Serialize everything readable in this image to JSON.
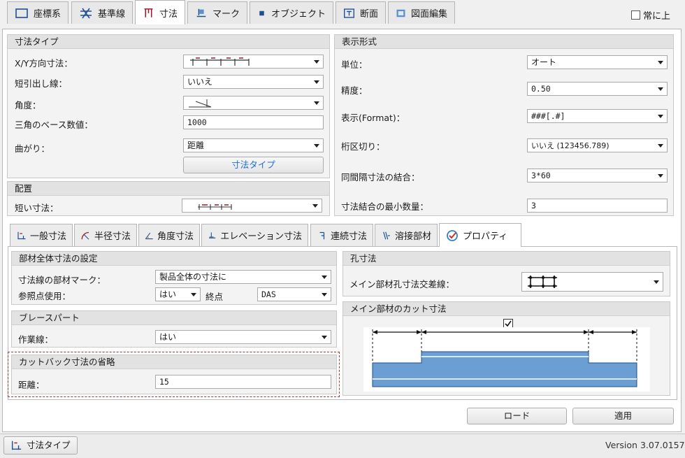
{
  "top_tabs": [
    {
      "label": "座標系",
      "icon": "coordinate-icon"
    },
    {
      "label": "基準線",
      "icon": "grid-icon"
    },
    {
      "label": "寸法",
      "icon": "dimension-icon"
    },
    {
      "label": "マーク",
      "icon": "mark-icon"
    },
    {
      "label": "オブジェクト",
      "icon": "object-icon"
    },
    {
      "label": "断面",
      "icon": "section-icon"
    },
    {
      "label": "図面編集",
      "icon": "drawing-edit-icon"
    }
  ],
  "always_on_top": {
    "label": "常に上",
    "checked": false
  },
  "dimension_type": {
    "title": "寸法タイプ",
    "xy_label": "X/Y方向寸法：",
    "leader_label": "短引出し線：",
    "leader_value": "いいえ",
    "angle_label": "角度：",
    "triangle_label": "三角のベース数値：",
    "triangle_value": "1000",
    "curve_label": "曲がり：",
    "curve_value": "距離",
    "button": "寸法タイプ"
  },
  "placement": {
    "title": "配置",
    "short_label": "短い寸法："
  },
  "display_format": {
    "title": "表示形式",
    "unit_label": "単位：",
    "unit_value": "オート",
    "precision_label": "精度：",
    "precision_value": "0.50",
    "format_label": "表示(Format)：",
    "format_value": "###[.#]",
    "digit_label": "桁区切り：",
    "digit_value": "いいえ (123456.789)",
    "combine_label": "同間隔寸法の結合：",
    "combine_value": "3*60",
    "min_label": "寸法結合の最小数量：",
    "min_value": "3"
  },
  "sub_tabs": [
    {
      "label": "一般寸法",
      "icon": "general-dimension-icon"
    },
    {
      "label": "半径寸法",
      "icon": "radius-dimension-icon"
    },
    {
      "label": "角度寸法",
      "icon": "angle-dimension-icon"
    },
    {
      "label": "エレベーション寸法",
      "icon": "elevation-dimension-icon"
    },
    {
      "label": "連続寸法",
      "icon": "continuous-dimension-icon"
    },
    {
      "label": "溶接部材",
      "icon": "weld-icon"
    },
    {
      "label": "プロパティ",
      "icon": "properties-icon"
    }
  ],
  "part_settings": {
    "title": "部材全体寸法の設定",
    "mark_label": "寸法線の部材マーク：",
    "mark_value": "製品全体の寸法に",
    "ref_label": "参照点使用：",
    "ref_value": "はい",
    "end_label": "終点",
    "end_value": "DAS"
  },
  "brace": {
    "title": "ブレースパート",
    "work_label": "作業線：",
    "work_value": "はい"
  },
  "cutback": {
    "title": "カットバック寸法の省略",
    "distance_label": "距離：",
    "distance_value": "15"
  },
  "hole": {
    "title": "孔寸法",
    "cross_label": "メイン部材孔寸法交差線："
  },
  "cut_dim": {
    "title": "メイン部材のカット寸法",
    "checked": true,
    "beam_color": "#6b9fd4"
  },
  "buttons": {
    "load": "ロード",
    "apply": "適用"
  },
  "status": {
    "tab_label": "寸法タイプ",
    "version": "Version 3.07.0157"
  }
}
